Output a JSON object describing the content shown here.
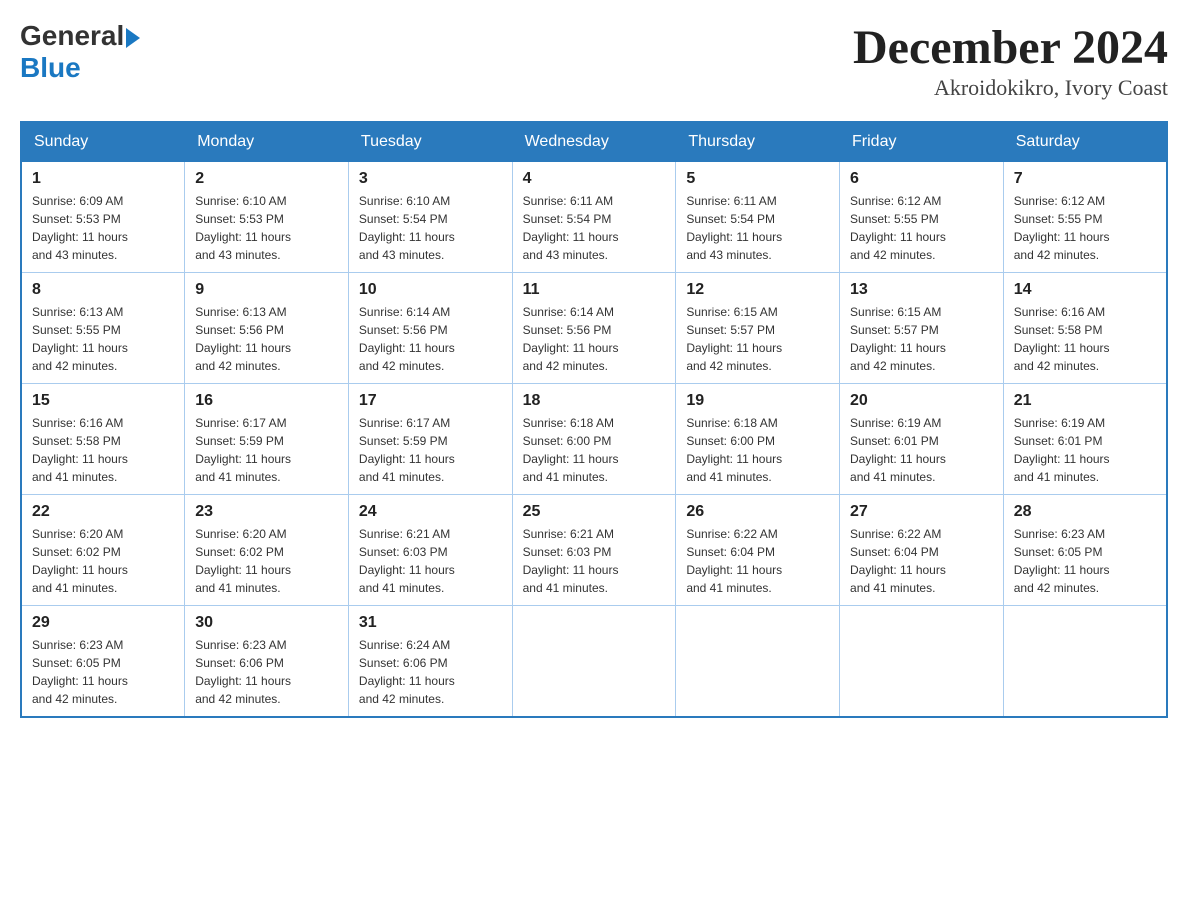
{
  "header": {
    "logo": {
      "general": "General",
      "arrow": "▶",
      "blue": "Blue"
    },
    "title": "December 2024",
    "location": "Akroidokikro, Ivory Coast"
  },
  "weekdays": [
    "Sunday",
    "Monday",
    "Tuesday",
    "Wednesday",
    "Thursday",
    "Friday",
    "Saturday"
  ],
  "weeks": [
    [
      {
        "day": "1",
        "sunrise": "6:09 AM",
        "sunset": "5:53 PM",
        "daylight": "11 hours and 43 minutes."
      },
      {
        "day": "2",
        "sunrise": "6:10 AM",
        "sunset": "5:53 PM",
        "daylight": "11 hours and 43 minutes."
      },
      {
        "day": "3",
        "sunrise": "6:10 AM",
        "sunset": "5:54 PM",
        "daylight": "11 hours and 43 minutes."
      },
      {
        "day": "4",
        "sunrise": "6:11 AM",
        "sunset": "5:54 PM",
        "daylight": "11 hours and 43 minutes."
      },
      {
        "day": "5",
        "sunrise": "6:11 AM",
        "sunset": "5:54 PM",
        "daylight": "11 hours and 43 minutes."
      },
      {
        "day": "6",
        "sunrise": "6:12 AM",
        "sunset": "5:55 PM",
        "daylight": "11 hours and 42 minutes."
      },
      {
        "day": "7",
        "sunrise": "6:12 AM",
        "sunset": "5:55 PM",
        "daylight": "11 hours and 42 minutes."
      }
    ],
    [
      {
        "day": "8",
        "sunrise": "6:13 AM",
        "sunset": "5:55 PM",
        "daylight": "11 hours and 42 minutes."
      },
      {
        "day": "9",
        "sunrise": "6:13 AM",
        "sunset": "5:56 PM",
        "daylight": "11 hours and 42 minutes."
      },
      {
        "day": "10",
        "sunrise": "6:14 AM",
        "sunset": "5:56 PM",
        "daylight": "11 hours and 42 minutes."
      },
      {
        "day": "11",
        "sunrise": "6:14 AM",
        "sunset": "5:56 PM",
        "daylight": "11 hours and 42 minutes."
      },
      {
        "day": "12",
        "sunrise": "6:15 AM",
        "sunset": "5:57 PM",
        "daylight": "11 hours and 42 minutes."
      },
      {
        "day": "13",
        "sunrise": "6:15 AM",
        "sunset": "5:57 PM",
        "daylight": "11 hours and 42 minutes."
      },
      {
        "day": "14",
        "sunrise": "6:16 AM",
        "sunset": "5:58 PM",
        "daylight": "11 hours and 42 minutes."
      }
    ],
    [
      {
        "day": "15",
        "sunrise": "6:16 AM",
        "sunset": "5:58 PM",
        "daylight": "11 hours and 41 minutes."
      },
      {
        "day": "16",
        "sunrise": "6:17 AM",
        "sunset": "5:59 PM",
        "daylight": "11 hours and 41 minutes."
      },
      {
        "day": "17",
        "sunrise": "6:17 AM",
        "sunset": "5:59 PM",
        "daylight": "11 hours and 41 minutes."
      },
      {
        "day": "18",
        "sunrise": "6:18 AM",
        "sunset": "6:00 PM",
        "daylight": "11 hours and 41 minutes."
      },
      {
        "day": "19",
        "sunrise": "6:18 AM",
        "sunset": "6:00 PM",
        "daylight": "11 hours and 41 minutes."
      },
      {
        "day": "20",
        "sunrise": "6:19 AM",
        "sunset": "6:01 PM",
        "daylight": "11 hours and 41 minutes."
      },
      {
        "day": "21",
        "sunrise": "6:19 AM",
        "sunset": "6:01 PM",
        "daylight": "11 hours and 41 minutes."
      }
    ],
    [
      {
        "day": "22",
        "sunrise": "6:20 AM",
        "sunset": "6:02 PM",
        "daylight": "11 hours and 41 minutes."
      },
      {
        "day": "23",
        "sunrise": "6:20 AM",
        "sunset": "6:02 PM",
        "daylight": "11 hours and 41 minutes."
      },
      {
        "day": "24",
        "sunrise": "6:21 AM",
        "sunset": "6:03 PM",
        "daylight": "11 hours and 41 minutes."
      },
      {
        "day": "25",
        "sunrise": "6:21 AM",
        "sunset": "6:03 PM",
        "daylight": "11 hours and 41 minutes."
      },
      {
        "day": "26",
        "sunrise": "6:22 AM",
        "sunset": "6:04 PM",
        "daylight": "11 hours and 41 minutes."
      },
      {
        "day": "27",
        "sunrise": "6:22 AM",
        "sunset": "6:04 PM",
        "daylight": "11 hours and 41 minutes."
      },
      {
        "day": "28",
        "sunrise": "6:23 AM",
        "sunset": "6:05 PM",
        "daylight": "11 hours and 42 minutes."
      }
    ],
    [
      {
        "day": "29",
        "sunrise": "6:23 AM",
        "sunset": "6:05 PM",
        "daylight": "11 hours and 42 minutes."
      },
      {
        "day": "30",
        "sunrise": "6:23 AM",
        "sunset": "6:06 PM",
        "daylight": "11 hours and 42 minutes."
      },
      {
        "day": "31",
        "sunrise": "6:24 AM",
        "sunset": "6:06 PM",
        "daylight": "11 hours and 42 minutes."
      },
      null,
      null,
      null,
      null
    ]
  ],
  "labels": {
    "sunrise": "Sunrise:",
    "sunset": "Sunset:",
    "daylight": "Daylight:"
  }
}
